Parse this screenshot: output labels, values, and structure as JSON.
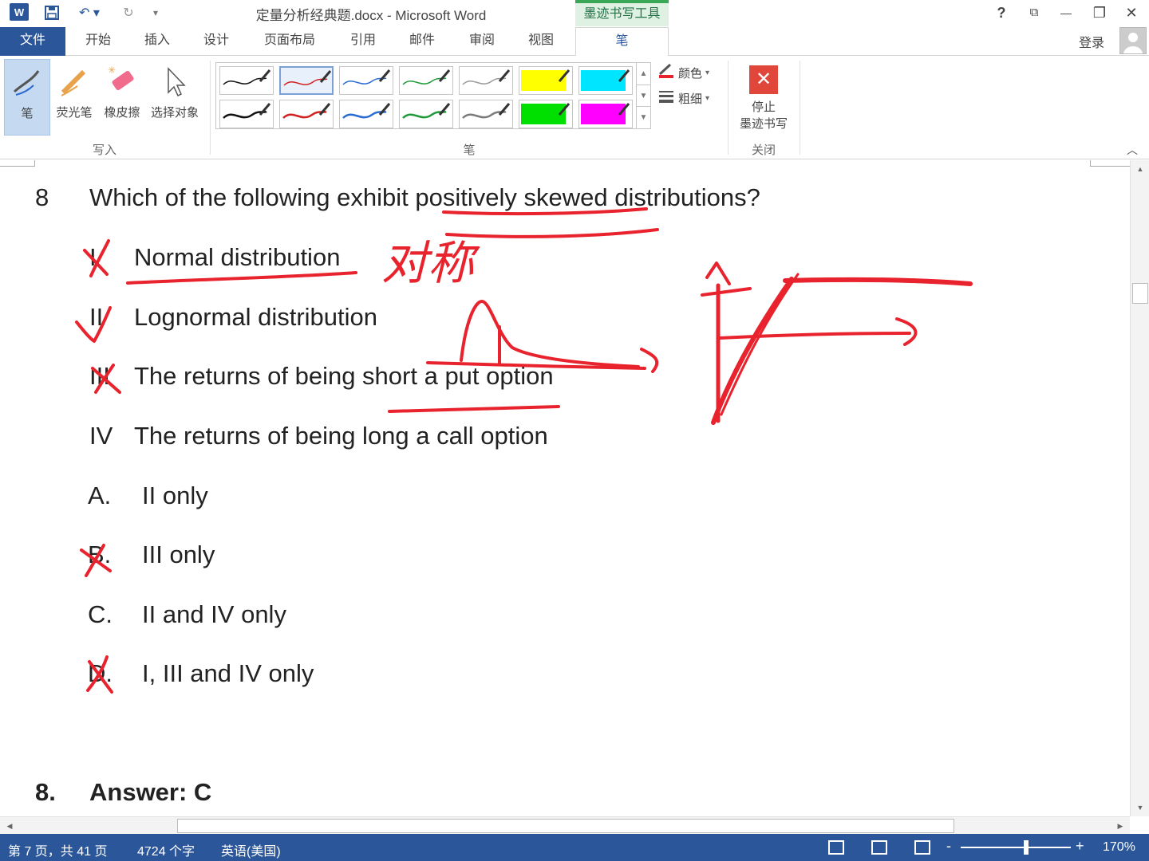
{
  "titlebar": {
    "title": "定量分析经典题.docx - Microsoft Word",
    "context_tab": "墨迹书写工具",
    "help": "?",
    "restore_ribbon": "⧉",
    "minimize": "—",
    "restore": "❐",
    "close": "✕"
  },
  "tabs": [
    "文件",
    "开始",
    "插入",
    "设计",
    "页面布局",
    "引用",
    "邮件",
    "审阅",
    "视图",
    "笔"
  ],
  "account": {
    "login": "登录"
  },
  "ribbon": {
    "write_group": {
      "label": "写入",
      "pen": "笔",
      "highlighter": "荧光笔",
      "eraser": "橡皮擦",
      "select": "选择对象"
    },
    "pens_group": {
      "label": "笔",
      "pens": [
        {
          "color": "#111111",
          "kind": "pen"
        },
        {
          "color": "#d22020",
          "kind": "pen"
        },
        {
          "color": "#2a6bd2",
          "kind": "pen"
        },
        {
          "color": "#1f9a3a",
          "kind": "pen"
        },
        {
          "color": "#9a9a9a",
          "kind": "pen"
        },
        {
          "color": "#ffff00",
          "kind": "highlighter"
        },
        {
          "color": "#00e5ff",
          "kind": "highlighter"
        },
        {
          "color": "#111111",
          "kind": "pen"
        },
        {
          "color": "#d22020",
          "kind": "pen"
        },
        {
          "color": "#2a6bd2",
          "kind": "pen"
        },
        {
          "color": "#1f9a3a",
          "kind": "pen"
        },
        {
          "color": "#7a7a7a",
          "kind": "pen"
        },
        {
          "color": "#00e000",
          "kind": "highlighter"
        },
        {
          "color": "#ff00ff",
          "kind": "highlighter"
        }
      ],
      "selected_index": 1,
      "color": "颜色",
      "thickness": "粗细"
    },
    "close_group": {
      "label": "关闭",
      "stop_line1": "停止",
      "stop_line2": "墨迹书写"
    }
  },
  "document": {
    "question": {
      "number": "8",
      "text": "Which of the following exhibit positively skewed distributions?",
      "items": [
        {
          "roman": "I",
          "text": "Normal distribution"
        },
        {
          "roman": "II",
          "text": "Lognormal distribution"
        },
        {
          "roman": "III",
          "text": "The returns of being short a put option"
        },
        {
          "roman": "IV",
          "text": "The returns of being long a call option"
        }
      ],
      "options": [
        {
          "letter": "A.",
          "text": "II only"
        },
        {
          "letter": "B.",
          "text": "III only"
        },
        {
          "letter": "C.",
          "text": "II and IV only"
        },
        {
          "letter": "D.",
          "text": "I, III and IV only"
        }
      ]
    },
    "answer": {
      "number": "8.",
      "text": "Answer: C"
    },
    "ink_annotation": "对称",
    "ink_color": "#e8232d"
  },
  "statusbar": {
    "page": "第 7 页，共 41 页",
    "words": "4724 个字",
    "language": "英语(美国)",
    "zoom_minus": "-",
    "zoom_plus": "+",
    "zoom": "170%"
  }
}
